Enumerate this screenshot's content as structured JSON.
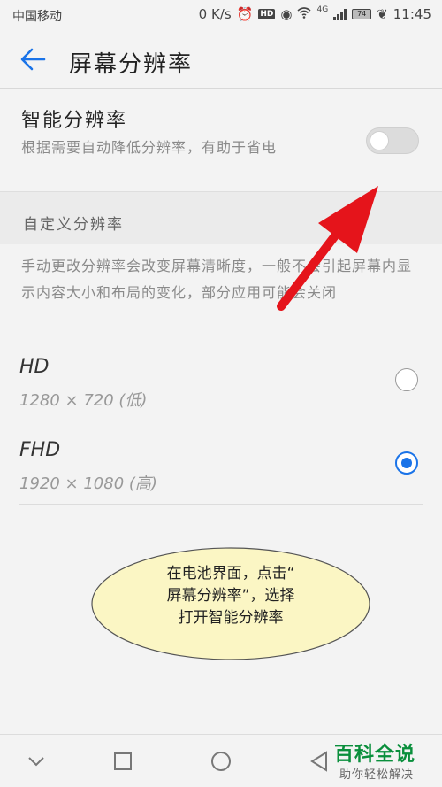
{
  "status_bar": {
    "carrier": "中国移动",
    "speed": "0 K/s",
    "network": "4G",
    "battery": "74",
    "time": "11:45"
  },
  "header": {
    "title": "屏幕分辨率",
    "back_icon": "arrow-left-icon"
  },
  "smart_resolution": {
    "title": "智能分辨率",
    "description": "根据需要自动降低分辨率，有助于省电",
    "enabled": false
  },
  "custom_resolution": {
    "section_title": "自定义分辨率",
    "description": "手动更改分辨率会改变屏幕清晰度，一般不会引起屏幕内显示内容大小和布局的变化，部分应用可能会关闭"
  },
  "options": [
    {
      "name": "HD",
      "spec": "1280 × 720 (低)",
      "selected": false
    },
    {
      "name": "FHD",
      "spec": "1920 × 1080 (高)",
      "selected": true
    }
  ],
  "annotation": {
    "line1": "在电池界面，点击“",
    "line2": "屏幕分辨率”，选择",
    "line3": "打开智能分辨率"
  },
  "watermark": {
    "brand": "百科全说",
    "tagline": "助你轻松解决"
  },
  "colors": {
    "accent": "#1a73e8",
    "arrow": "#e5141b",
    "bubble_fill": "#fbf6c4",
    "watermark": "#0a8f3c"
  }
}
